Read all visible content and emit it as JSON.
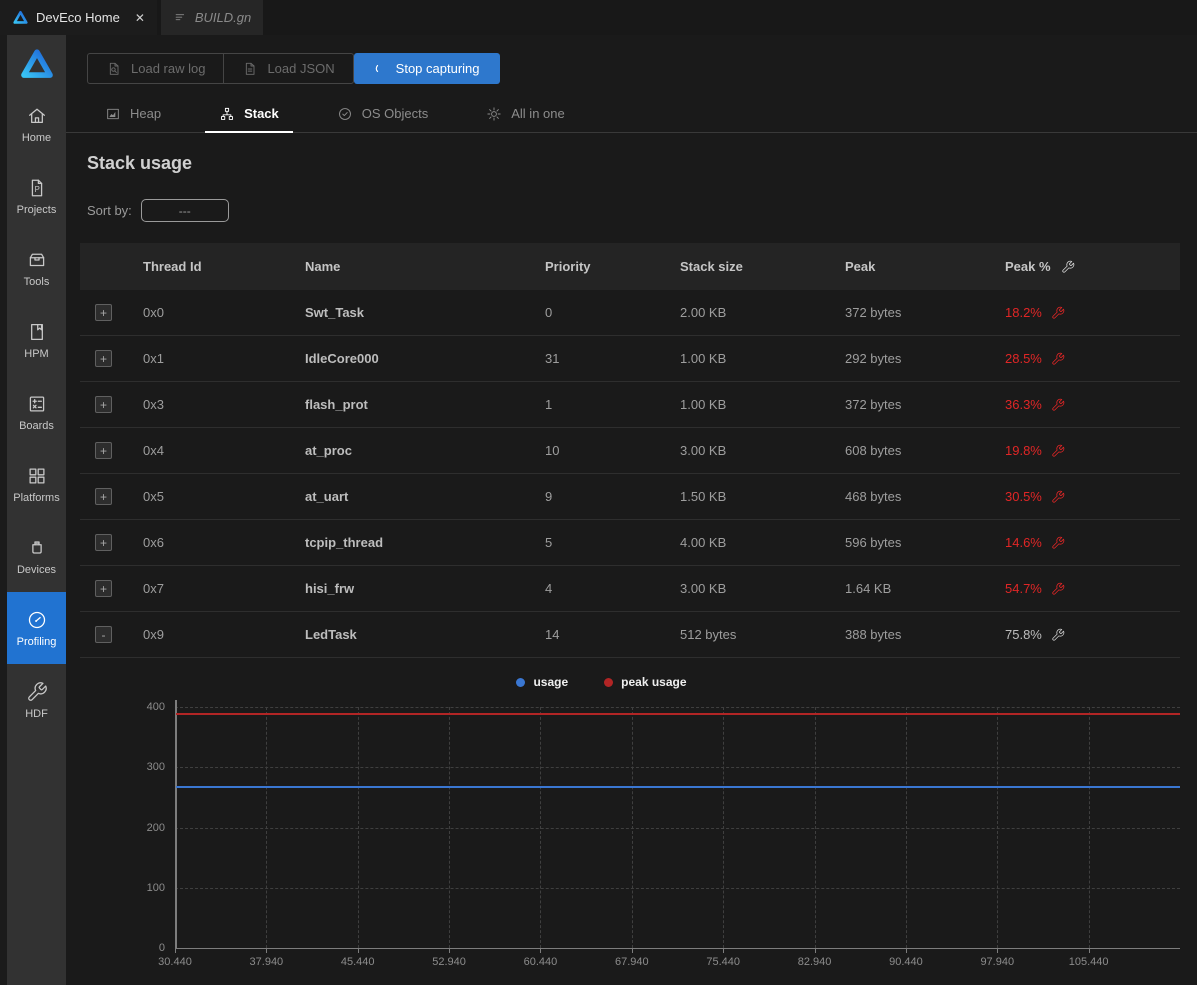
{
  "colors": {
    "accent_blue": "#2e78cd",
    "sidebar_active_blue": "#2173d1",
    "alert_red": "#e02626",
    "neutral_wrench": "#c9c9c9",
    "header_wrench": "#d5d5d5"
  },
  "editor_tabs": [
    {
      "label": "DevEco Home",
      "icon": "deveco-logo",
      "active": true,
      "closable": true
    },
    {
      "label": "BUILD.gn",
      "icon": "gn-file-icon",
      "active": false
    }
  ],
  "sidebar": {
    "items": [
      {
        "label": "Home",
        "icon": "home-icon",
        "active": false
      },
      {
        "label": "Projects",
        "icon": "projects-icon",
        "active": false
      },
      {
        "label": "Tools",
        "icon": "tools-icon",
        "active": false
      },
      {
        "label": "HPM",
        "icon": "hpm-icon",
        "active": false
      },
      {
        "label": "Boards",
        "icon": "boards-icon",
        "active": false
      },
      {
        "label": "Platforms",
        "icon": "platforms-icon",
        "active": false
      },
      {
        "label": "Devices",
        "icon": "devices-icon",
        "active": false
      },
      {
        "label": "Profiling",
        "icon": "profiling-icon",
        "active": true
      },
      {
        "label": "HDF",
        "icon": "hdf-icon",
        "active": false
      }
    ]
  },
  "toolbar": {
    "buttons": [
      {
        "label": "Load raw log",
        "icon": "file-search-icon",
        "style": "outline-disabled"
      },
      {
        "label": "Load JSON",
        "icon": "file-icon",
        "style": "outline-disabled"
      },
      {
        "label": "Stop capturing",
        "icon": "spinner-icon",
        "style": "primary"
      }
    ]
  },
  "view_tabs": [
    {
      "label": "Heap",
      "icon": "heap-icon",
      "active": false
    },
    {
      "label": "Stack",
      "icon": "stack-icon",
      "active": true
    },
    {
      "label": "OS Objects",
      "icon": "shield-check-icon",
      "active": false
    },
    {
      "label": "All in one",
      "icon": "gear-icon",
      "active": false
    }
  ],
  "section": {
    "title": "Stack usage",
    "sort_label": "Sort by:",
    "sort_value": "---"
  },
  "table": {
    "headers": [
      "Thread Id",
      "Name",
      "Priority",
      "Stack size",
      "Peak",
      "Peak %"
    ],
    "rows": [
      {
        "expand": "+",
        "thread_id": "0x0",
        "name": "Swt_Task",
        "priority": "0",
        "stack_size": "2.00 KB",
        "peak": "372 bytes",
        "peak_pct": "18.2%",
        "alert": true
      },
      {
        "expand": "+",
        "thread_id": "0x1",
        "name": "IdleCore000",
        "priority": "31",
        "stack_size": "1.00 KB",
        "peak": "292 bytes",
        "peak_pct": "28.5%",
        "alert": true
      },
      {
        "expand": "+",
        "thread_id": "0x3",
        "name": "flash_prot",
        "priority": "1",
        "stack_size": "1.00 KB",
        "peak": "372 bytes",
        "peak_pct": "36.3%",
        "alert": true
      },
      {
        "expand": "+",
        "thread_id": "0x4",
        "name": "at_proc",
        "priority": "10",
        "stack_size": "3.00 KB",
        "peak": "608 bytes",
        "peak_pct": "19.8%",
        "alert": true
      },
      {
        "expand": "+",
        "thread_id": "0x5",
        "name": "at_uart",
        "priority": "9",
        "stack_size": "1.50 KB",
        "peak": "468 bytes",
        "peak_pct": "30.5%",
        "alert": true
      },
      {
        "expand": "+",
        "thread_id": "0x6",
        "name": "tcpip_thread",
        "priority": "5",
        "stack_size": "4.00 KB",
        "peak": "596 bytes",
        "peak_pct": "14.6%",
        "alert": true
      },
      {
        "expand": "+",
        "thread_id": "0x7",
        "name": "hisi_frw",
        "priority": "4",
        "stack_size": "3.00 KB",
        "peak": "1.64 KB",
        "peak_pct": "54.7%",
        "alert": true
      },
      {
        "expand": "-",
        "thread_id": "0x9",
        "name": "LedTask",
        "priority": "14",
        "stack_size": "512 bytes",
        "peak": "388 bytes",
        "peak_pct": "75.8%",
        "alert": false
      }
    ]
  },
  "chart_data": {
    "type": "line",
    "title": "",
    "xlabel": "",
    "ylabel": "",
    "x": [
      30.44,
      37.94,
      45.44,
      52.94,
      60.44,
      67.94,
      75.44,
      82.94,
      90.44,
      97.94,
      105.44
    ],
    "x_labels": [
      "30.440",
      "37.940",
      "45.440",
      "52.940",
      "60.440",
      "67.940",
      "75.440",
      "82.940",
      "90.440",
      "97.940",
      "105.440"
    ],
    "ylim": [
      0,
      400
    ],
    "yticks": [
      0,
      100,
      200,
      300,
      400
    ],
    "grid": true,
    "legend_position": "top-center",
    "series": [
      {
        "name": "usage",
        "color": "#3a77d2",
        "values": [
          268,
          268,
          268,
          268,
          268,
          268,
          268,
          268,
          268,
          268,
          268
        ]
      },
      {
        "name": "peak usage",
        "color": "#b22525",
        "values": [
          388,
          388,
          388,
          388,
          388,
          388,
          388,
          388,
          388,
          388,
          388
        ]
      }
    ]
  }
}
